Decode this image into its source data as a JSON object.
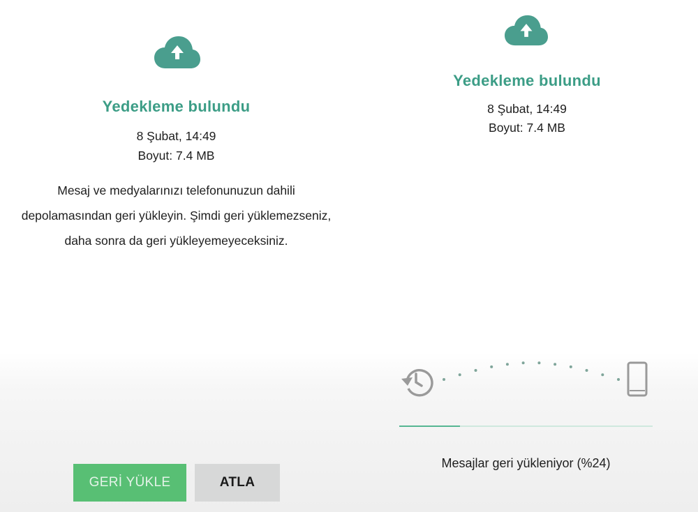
{
  "colors": {
    "accent": "#3c9d86",
    "restore_button": "#58bf74",
    "skip_button": "#d7d8d8"
  },
  "left": {
    "icon": "cloud-upload-icon",
    "title": "Yedekleme bulundu",
    "date": "8 Şubat, 14:49",
    "size": "Boyut: 7.4 MB",
    "description_lines": [
      "Mesaj ve medyalarınızı telefonunuzun dahili",
      "depolamasından geri yükleyin. Şimdi geri yüklemezseniz,",
      "daha sonra da geri yükleyemeyeceksiniz."
    ],
    "restore_label": "GERİ YÜKLE",
    "skip_label": "ATLA"
  },
  "right": {
    "icon": "cloud-upload-icon",
    "title": "Yedekleme bulundu",
    "date": "8 Şubat, 14:49",
    "size": "Boyut: 7.4 MB",
    "progress_percent": 24,
    "status": "Mesajlar geri yükleniyor (%24)",
    "source_icon": "restore-history-icon",
    "target_icon": "phone-icon"
  }
}
